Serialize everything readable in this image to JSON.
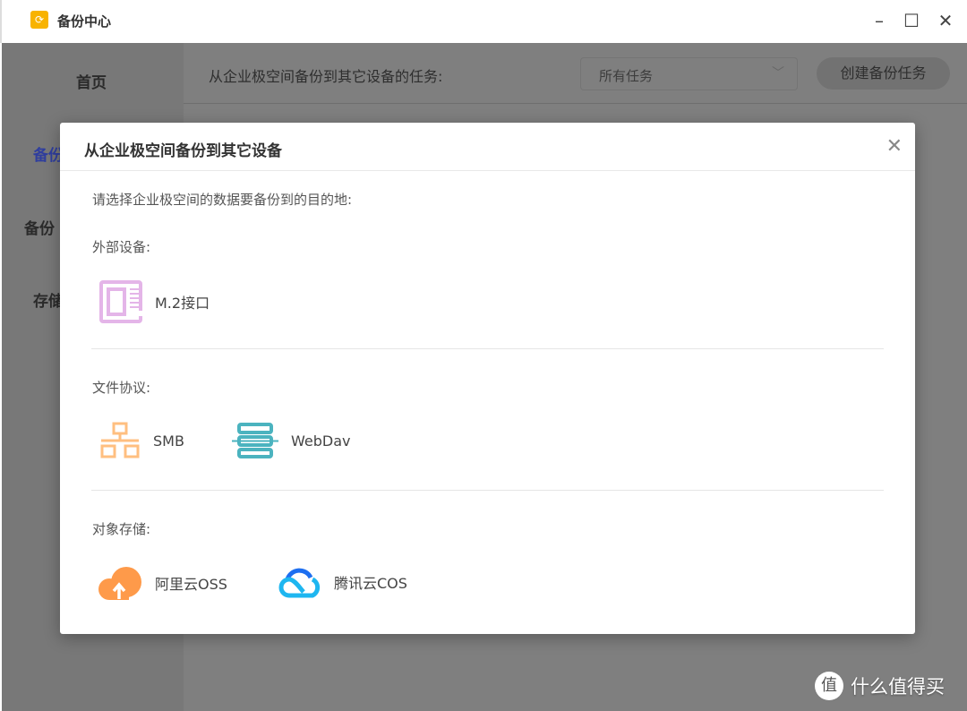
{
  "window": {
    "title": "备份中心",
    "icon": "refresh-icon",
    "controls": [
      "minimize-icon",
      "maximize-icon",
      "close-icon"
    ]
  },
  "sidebar": {
    "items": [
      {
        "label": "首页"
      },
      {
        "label": "备份"
      },
      {
        "label": "备份"
      },
      {
        "label": "存储"
      }
    ],
    "active_color": "#2f3e9e"
  },
  "main": {
    "header_label": "从企业极空间备份到其它设备的任务:",
    "filter": {
      "value": "所有任务"
    },
    "create_button": "创建备份任务"
  },
  "dialog": {
    "title": "从企业极空间备份到其它设备",
    "prompt": "请选择企业极空间的数据要备份到的目的地:",
    "sections": [
      {
        "label": "外部设备:",
        "options": [
          {
            "name": "M.2接口",
            "icon": "m2-slot-icon",
            "color": "#e4b5e8"
          }
        ]
      },
      {
        "label": "文件协议:",
        "options": [
          {
            "name": "SMB",
            "icon": "network-icon",
            "color": "#ffbf80"
          },
          {
            "name": "WebDav",
            "icon": "server-icon",
            "color": "#4bb3bf"
          }
        ]
      },
      {
        "label": "对象存储:",
        "options": [
          {
            "name": "阿里云OSS",
            "icon": "aliyun-cloud-icon",
            "color": "#fe9a4a"
          },
          {
            "name": "腾讯云COS",
            "icon": "tencent-cloud-icon",
            "color": "#1e9af0"
          }
        ]
      }
    ]
  },
  "watermark": {
    "badge": "值",
    "text": "什么值得买"
  }
}
